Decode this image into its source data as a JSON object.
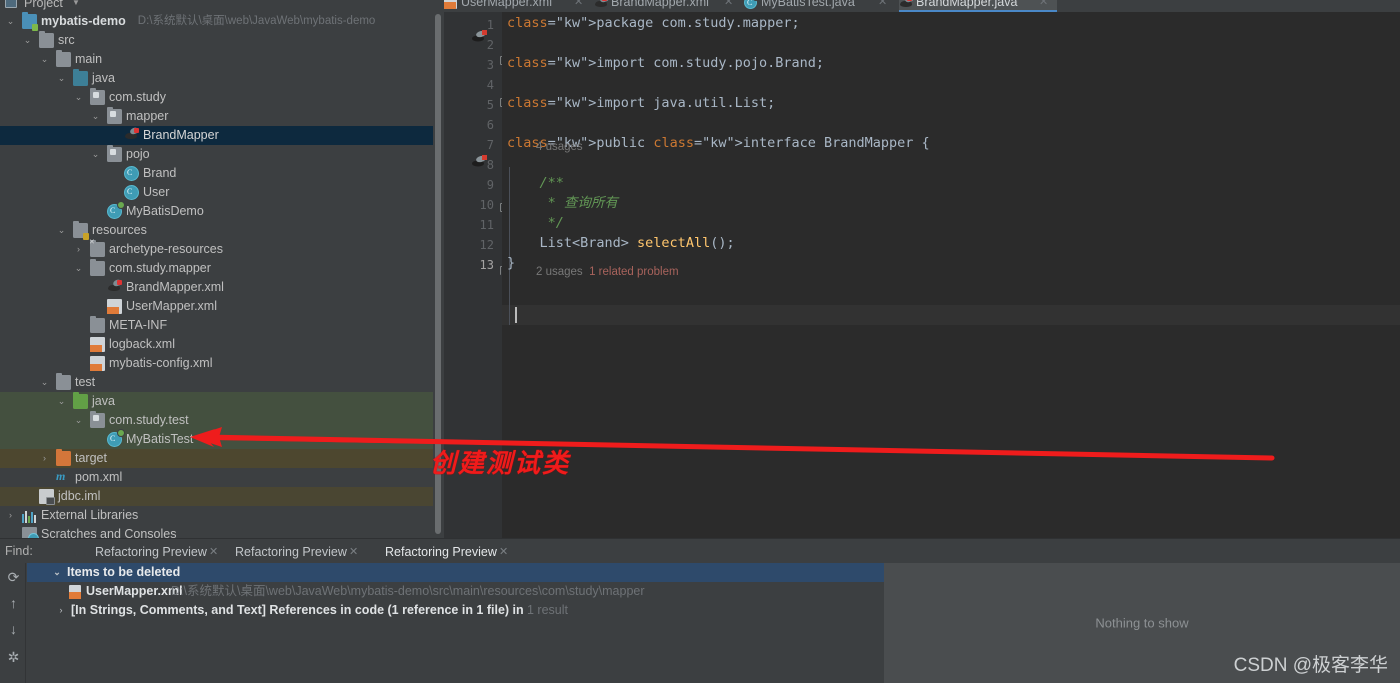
{
  "toolbar": {
    "project_label": "Project",
    "icons": [
      "anchor-icon",
      "collapse-all-icon",
      "expand-up-icon",
      "settings-down-icon"
    ]
  },
  "tree": {
    "items": [
      {
        "label": "mybatis-demo",
        "sub": "D:\\系统默认\\桌面\\web\\JavaWeb\\mybatis-demo",
        "indent": 0,
        "arrow": "v",
        "icon": "module-folder-icon",
        "state": "normal",
        "bold": true
      },
      {
        "label": "src",
        "sub": "",
        "indent": 1,
        "arrow": "v",
        "icon": "folder-icon",
        "state": "normal"
      },
      {
        "label": "main",
        "sub": "",
        "indent": 2,
        "arrow": "v",
        "icon": "folder-icon",
        "state": "normal"
      },
      {
        "label": "java",
        "sub": "",
        "indent": 3,
        "arrow": "v",
        "icon": "source-folder-icon",
        "state": "normal"
      },
      {
        "label": "com.study",
        "sub": "",
        "indent": 4,
        "arrow": "v",
        "icon": "package-icon",
        "state": "normal"
      },
      {
        "label": "mapper",
        "sub": "",
        "indent": 5,
        "arrow": "v",
        "icon": "package-icon",
        "state": "normal"
      },
      {
        "label": "BrandMapper",
        "sub": "",
        "indent": 6,
        "arrow": "",
        "icon": "mybatis-mapper-icon",
        "state": "selected"
      },
      {
        "label": "pojo",
        "sub": "",
        "indent": 5,
        "arrow": "v",
        "icon": "package-icon",
        "state": "normal"
      },
      {
        "label": "Brand",
        "sub": "",
        "indent": 6,
        "arrow": "",
        "icon": "java-class-icon",
        "state": "normal"
      },
      {
        "label": "User",
        "sub": "",
        "indent": 6,
        "arrow": "",
        "icon": "java-class-icon",
        "state": "normal"
      },
      {
        "label": "MyBatisDemo",
        "sub": "",
        "indent": 5,
        "arrow": "",
        "icon": "java-runnable-class-icon",
        "state": "normal"
      },
      {
        "label": "resources",
        "sub": "",
        "indent": 3,
        "arrow": "v",
        "icon": "resources-folder-icon",
        "state": "normal"
      },
      {
        "label": "archetype-resources",
        "sub": "",
        "indent": 4,
        "arrow": ">",
        "icon": "excluded-folder-icon",
        "state": "normal"
      },
      {
        "label": "com.study.mapper",
        "sub": "",
        "indent": 4,
        "arrow": "v",
        "icon": "folder-icon",
        "state": "normal"
      },
      {
        "label": "BrandMapper.xml",
        "sub": "",
        "indent": 5,
        "arrow": "",
        "icon": "mybatis-mapper-icon",
        "state": "normal"
      },
      {
        "label": "UserMapper.xml",
        "sub": "",
        "indent": 5,
        "arrow": "",
        "icon": "xml-file-icon",
        "state": "normal"
      },
      {
        "label": "META-INF",
        "sub": "",
        "indent": 4,
        "arrow": "",
        "icon": "folder-icon",
        "state": "normal"
      },
      {
        "label": "logback.xml",
        "sub": "",
        "indent": 4,
        "arrow": "",
        "icon": "xml-file-icon",
        "state": "normal"
      },
      {
        "label": "mybatis-config.xml",
        "sub": "",
        "indent": 4,
        "arrow": "",
        "icon": "xml-file-icon",
        "state": "normal"
      },
      {
        "label": "test",
        "sub": "",
        "indent": 2,
        "arrow": "v",
        "icon": "folder-icon",
        "state": "normal"
      },
      {
        "label": "java",
        "sub": "",
        "indent": 3,
        "arrow": "v",
        "icon": "test-source-folder-icon",
        "state": "green"
      },
      {
        "label": "com.study.test",
        "sub": "",
        "indent": 4,
        "arrow": "v",
        "icon": "package-icon",
        "state": "green"
      },
      {
        "label": "MyBatisTest",
        "sub": "",
        "indent": 5,
        "arrow": "",
        "icon": "java-runnable-class-icon",
        "state": "green"
      },
      {
        "label": "target",
        "sub": "",
        "indent": 2,
        "arrow": ">",
        "icon": "excluded-target-folder-icon",
        "state": "olive"
      },
      {
        "label": "pom.xml",
        "sub": "",
        "indent": 2,
        "arrow": "",
        "icon": "maven-pom-icon",
        "state": "normal"
      },
      {
        "label": "jdbc.iml",
        "sub": "",
        "indent": 1,
        "arrow": "",
        "icon": "iml-module-file-icon",
        "state": "olive2"
      },
      {
        "label": "External Libraries",
        "sub": "",
        "indent": 0,
        "arrow": ">",
        "icon": "libraries-icon",
        "state": "normal"
      },
      {
        "label": "Scratches and Consoles",
        "sub": "",
        "indent": 0,
        "arrow": "",
        "icon": "scratches-icon",
        "state": "normal"
      }
    ]
  },
  "editor": {
    "tabs": [
      {
        "label": "UserMapper.xml",
        "icon": "xml-file-icon",
        "active": false
      },
      {
        "label": "BrandMapper.xml",
        "icon": "mybatis-mapper-icon",
        "active": false
      },
      {
        "label": "MyBatisTest.java",
        "icon": "java-runnable-class-icon",
        "active": false
      },
      {
        "label": "BrandMapper.java",
        "icon": "mybatis-mapper-icon",
        "active": true
      }
    ],
    "line_numbers": [
      "1",
      "2",
      "3",
      "4",
      "5",
      "6",
      "7",
      "8",
      "9",
      "10",
      "11",
      "12",
      "13"
    ],
    "code_lines": [
      {
        "n": 1,
        "text": "package com.study.mapper;"
      },
      {
        "n": 2,
        "text": ""
      },
      {
        "n": 3,
        "text": "import com.study.pojo.Brand;"
      },
      {
        "n": 4,
        "text": ""
      },
      {
        "n": 5,
        "text": "import java.util.List;"
      },
      {
        "n": 6,
        "text": ""
      },
      {
        "n": 7,
        "text": "public interface BrandMapper {"
      },
      {
        "n": 8,
        "text": ""
      },
      {
        "n": 9,
        "text": "    /**"
      },
      {
        "n": 10,
        "text": "     * 查询所有"
      },
      {
        "n": 11,
        "text": "     */"
      },
      {
        "n": 12,
        "text": "    List<Brand> selectAll();"
      },
      {
        "n": 13,
        "text": "}"
      }
    ],
    "hints": [
      {
        "line": 7,
        "usages": "4 usages",
        "problem": ""
      },
      {
        "line": 12,
        "usages": "2 usages",
        "problem": "1 related problem"
      }
    ]
  },
  "annotation": {
    "text": "创建测试类",
    "color": "#f01b1b"
  },
  "find_panel": {
    "find_label": "Find:",
    "tabs": [
      {
        "label": "Refactoring Preview",
        "active": false
      },
      {
        "label": "Refactoring Preview",
        "active": false
      },
      {
        "label": "Refactoring Preview",
        "active": true
      }
    ],
    "side_tools": [
      "refresh-icon",
      "arrow-up-icon",
      "arrow-down-icon",
      "settings-gear-icon"
    ],
    "results": [
      {
        "arrow": "v",
        "title": "Items to be deleted",
        "path": "",
        "kind": "header"
      },
      {
        "arrow": "",
        "title": "UserMapper.xml",
        "path": "D:\\系统默认\\桌面\\web\\JavaWeb\\mybatis-demo\\src\\main\\resources\\com\\study\\mapper",
        "kind": "file"
      },
      {
        "arrow": ">",
        "title": "[In Strings, Comments, and Text] References in code  (1 reference in 1 file) in",
        "path": "1 result",
        "kind": "group"
      }
    ],
    "preview_empty_text": "Nothing to show"
  },
  "watermark": {
    "text": "CSDN @极客李华"
  },
  "colors": {
    "panel_bg": "#3c3f41",
    "editor_bg": "#2b2b2b",
    "gutter_bg": "#313335",
    "selection_blue": "#0d293e",
    "test_green": "#44503f",
    "header_blue": "#2e4a6b",
    "accent_blue": "#4a88c7",
    "annotation_red": "#f01b1b"
  }
}
